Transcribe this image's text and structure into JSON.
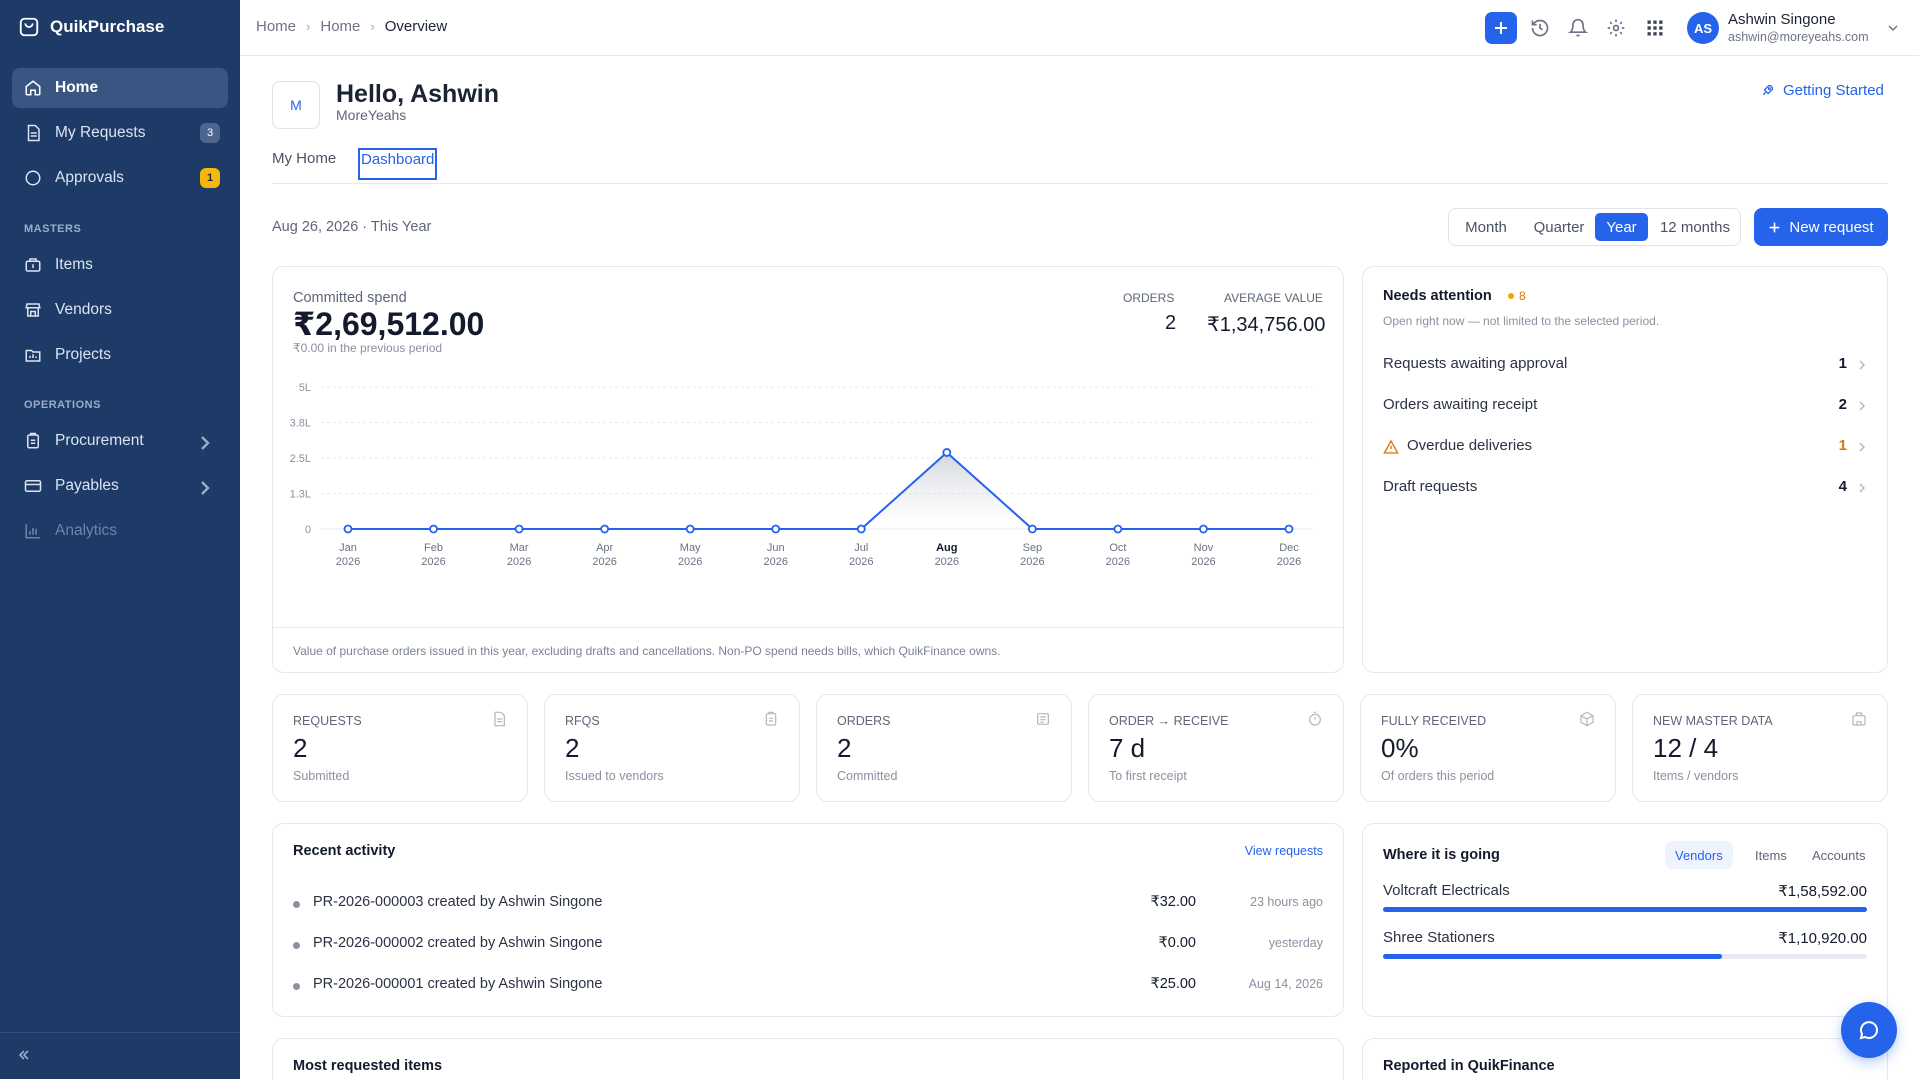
{
  "app": {
    "name": "QuikPurchase"
  },
  "sidebar": {
    "items": [
      {
        "label": "Home"
      },
      {
        "label": "My Requests",
        "badge": "3"
      },
      {
        "label": "Approvals",
        "badge": "1"
      }
    ],
    "sections": [
      {
        "title": "MASTERS",
        "items": [
          {
            "label": "Items"
          },
          {
            "label": "Vendors"
          },
          {
            "label": "Projects"
          }
        ]
      },
      {
        "title": "OPERATIONS",
        "items": [
          {
            "label": "Procurement"
          },
          {
            "label": "Payables"
          },
          {
            "label": "Analytics"
          }
        ]
      }
    ]
  },
  "topbar": {
    "breadcrumbs": [
      "Home",
      "Home",
      "Overview"
    ],
    "user": {
      "initials": "AS",
      "name": "Ashwin Singone",
      "email": "ashwin@moreyeahs.com"
    }
  },
  "header": {
    "org_initial": "M",
    "greeting": "Hello, Ashwin",
    "org_name": "MoreYeahs",
    "getting_started": "Getting Started",
    "tabs": [
      {
        "label": "My Home"
      },
      {
        "label": "Dashboard"
      }
    ]
  },
  "period": {
    "label": "Aug 26, 2026 · This Year",
    "options": [
      "Month",
      "Quarter",
      "Year",
      "12 months"
    ],
    "selected": "Year",
    "new_request": "New request"
  },
  "spend": {
    "label": "Committed spend",
    "value": "₹2,69,512.00",
    "previous": "₹0.00 in the previous period",
    "orders_label": "ORDERS",
    "orders_value": "2",
    "avg_label": "AVERAGE VALUE",
    "avg_value": "₹1,34,756.00",
    "footnote": "Value of purchase orders issued in this year, excluding drafts and cancellations. Non-PO spend needs bills, which QuikFinance owns."
  },
  "chart_data": {
    "type": "area",
    "categories": [
      "Jan 2026",
      "Feb 2026",
      "Mar 2026",
      "Apr 2026",
      "May 2026",
      "Jun 2026",
      "Jul 2026",
      "Aug 2026",
      "Sep 2026",
      "Oct 2026",
      "Nov 2026",
      "Dec 2026"
    ],
    "month_labels": [
      "Jan",
      "Feb",
      "Mar",
      "Apr",
      "May",
      "Jun",
      "Jul",
      "Aug",
      "Sep",
      "Oct",
      "Nov",
      "Dec"
    ],
    "year_label": "2026",
    "values": [
      0,
      0,
      0,
      0,
      0,
      0,
      0,
      269512,
      0,
      0,
      0,
      0
    ],
    "highlight": "Aug",
    "y_ticks": [
      {
        "value": 0,
        "label": "0"
      },
      {
        "value": 125000,
        "label": "1.3L"
      },
      {
        "value": 250000,
        "label": "2.5L"
      },
      {
        "value": 375000,
        "label": "3.8L"
      },
      {
        "value": 500000,
        "label": "5L"
      }
    ],
    "ylim": [
      0,
      500000
    ],
    "grid": true,
    "color": "#2563eb"
  },
  "attention": {
    "title": "Needs attention",
    "count": "8",
    "subtitle": "Open right now — not limited to the selected period.",
    "rows": [
      {
        "label": "Requests awaiting approval",
        "value": "1"
      },
      {
        "label": "Orders awaiting receipt",
        "value": "2"
      },
      {
        "label": "Overdue deliveries",
        "value": "1"
      },
      {
        "label": "Draft requests",
        "value": "4"
      }
    ]
  },
  "kpis": [
    {
      "label": "REQUESTS",
      "value": "2",
      "sub": "Submitted",
      "icon": "document-icon"
    },
    {
      "label": "RFQS",
      "value": "2",
      "sub": "Issued to vendors",
      "icon": "clipboard-icon"
    },
    {
      "label": "ORDERS",
      "value": "2",
      "sub": "Committed",
      "icon": "orders-icon"
    },
    {
      "label": "ORDER → RECEIVE",
      "value": "7 d",
      "sub": "To first receipt",
      "icon": "timer-icon"
    },
    {
      "label": "FULLY RECEIVED",
      "value": "0%",
      "sub": "Of orders this period",
      "icon": "package-icon"
    },
    {
      "label": "NEW MASTER DATA",
      "value": "12 / 4",
      "sub": "Items / vendors",
      "icon": "building-icon"
    }
  ],
  "activity": {
    "title": "Recent activity",
    "link": "View requests",
    "rows": [
      {
        "id": "PR-2026-000003",
        "text": " created by Ashwin Singone",
        "amount": "₹32.00",
        "when": "23 hours ago"
      },
      {
        "id": "PR-2026-000002",
        "text": " created by Ashwin Singone",
        "amount": "₹0.00",
        "when": "yesterday"
      },
      {
        "id": "PR-2026-000001",
        "text": " created by Ashwin Singone",
        "amount": "₹25.00",
        "when": "Aug 14, 2026"
      }
    ]
  },
  "where": {
    "title": "Where it is going",
    "tabs": [
      "Vendors",
      "Items",
      "Accounts"
    ],
    "selected": "Vendors",
    "rows": [
      {
        "name": "Voltcraft Electricals",
        "value": "₹1,58,592.00",
        "share": 1.0
      },
      {
        "name": "Shree Stationers",
        "value": "₹1,10,920.00",
        "share": 0.7
      }
    ]
  },
  "bottom": {
    "left_title": "Most requested items",
    "right_title": "Reported in QuikFinance"
  },
  "colors": {
    "sidebar": "#1e3a66",
    "accent": "#2563eb",
    "warning": "#d97706",
    "badge_yellow": "#f5b70c"
  }
}
